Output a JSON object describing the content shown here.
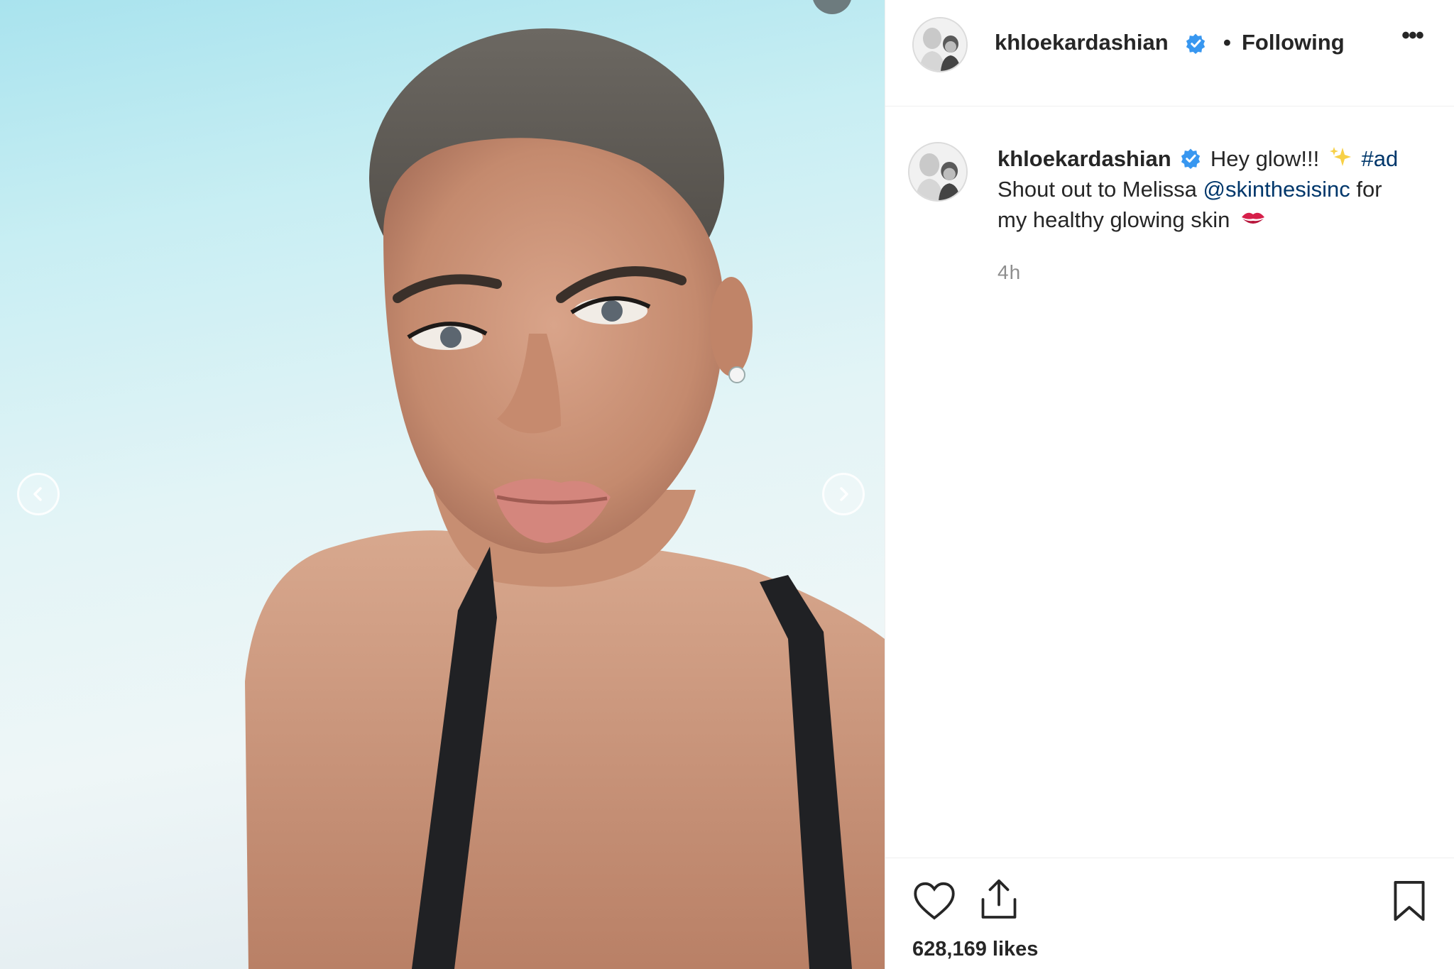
{
  "post": {
    "username": "khloekardashian",
    "follow_status": "Following",
    "separator": "•",
    "more_label": "•••",
    "caption": {
      "line1_text": "Hey glow!!!",
      "hashtag": "#ad",
      "line2_prefix": "Shout out to Melissa",
      "mention": "@skinthesisinc",
      "line2_suffix": "for",
      "line3_text": "my healthy glowing skin"
    },
    "timestamp": "4h",
    "likes_text": "628,169 likes"
  },
  "icons": {
    "verified": "verified-badge-icon",
    "sparkles": "sparkles-emoji-icon",
    "kiss": "kiss-mark-emoji-icon",
    "like": "heart-icon",
    "share": "share-icon",
    "save": "bookmark-icon",
    "prev": "chevron-left-icon",
    "next": "chevron-right-icon"
  },
  "colors": {
    "verified_blue": "#3897f0",
    "link_blue": "#00376b",
    "muted_gray": "#8e8e8e",
    "text": "#262626",
    "divider": "#efefef"
  }
}
